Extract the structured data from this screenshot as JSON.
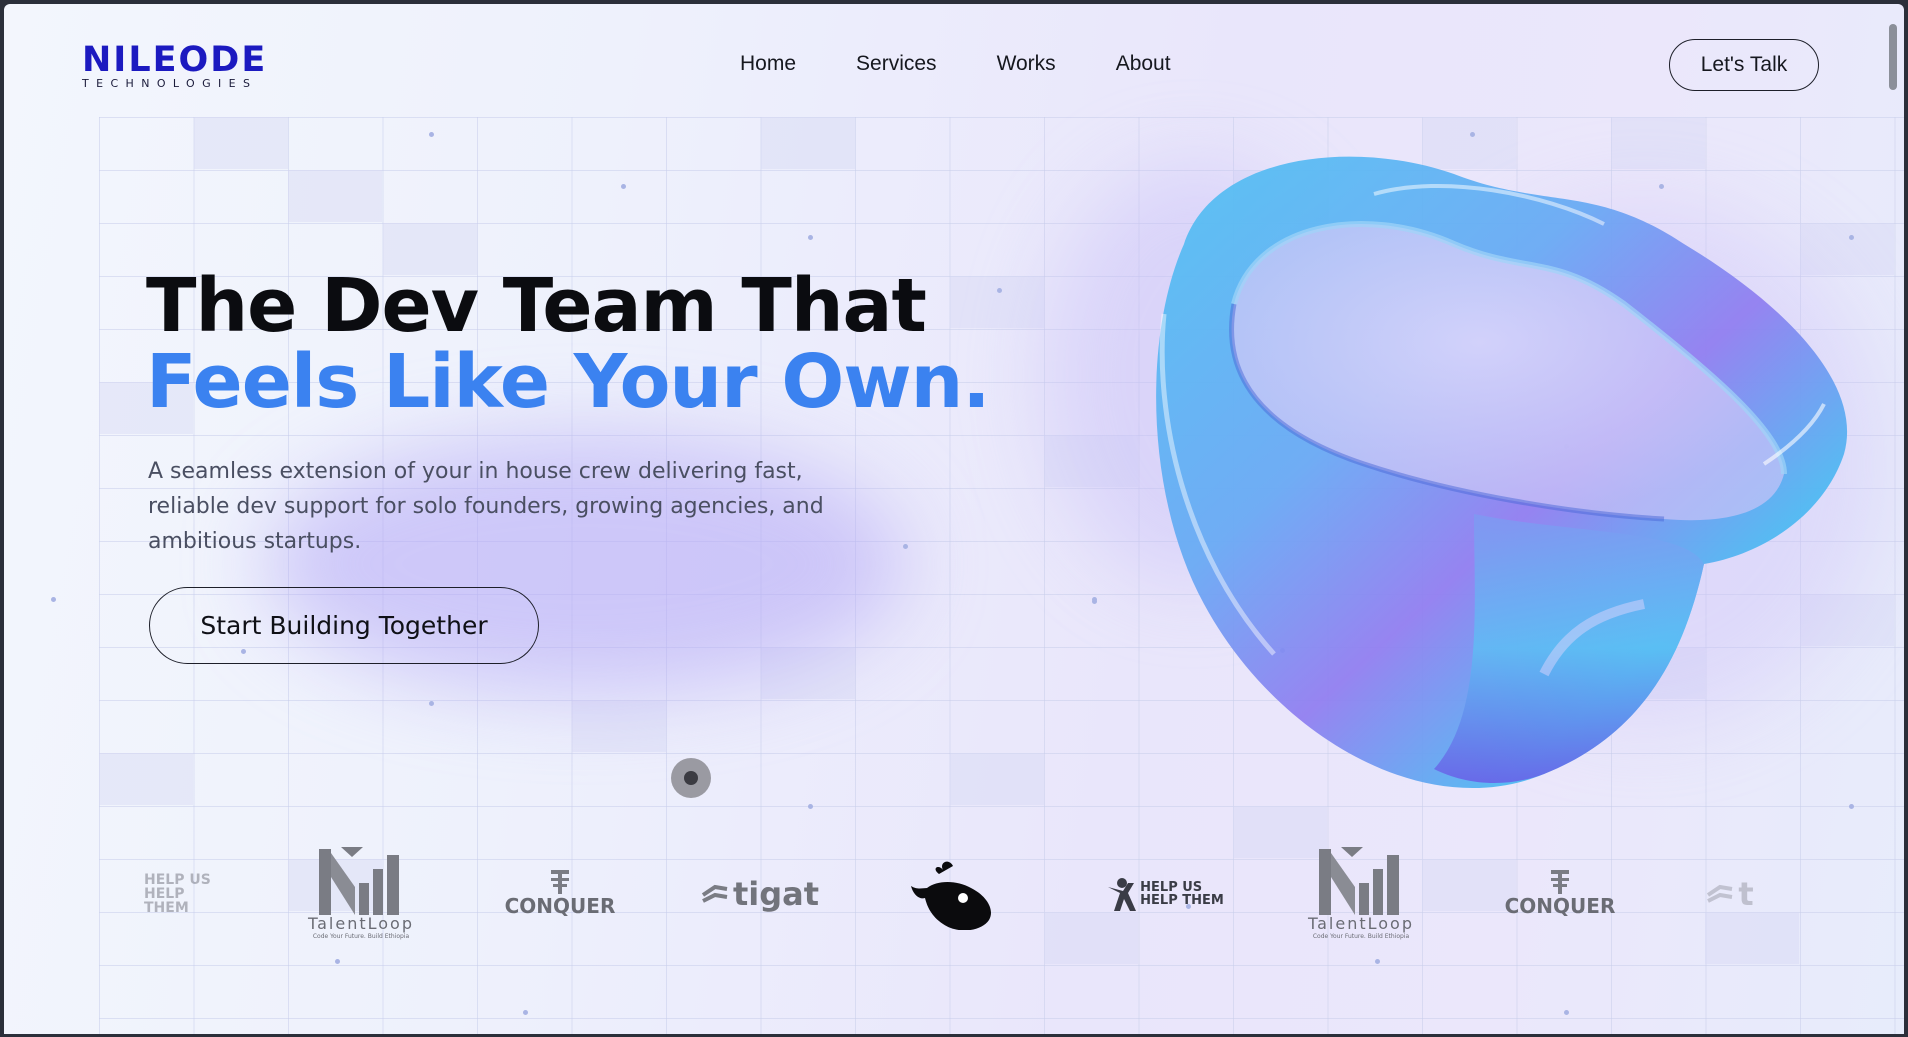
{
  "brand": {
    "name": "NILEODE",
    "tagline": "TECHNOLOGIES",
    "color": "#1c1ac0"
  },
  "nav": {
    "items": [
      {
        "label": "Home"
      },
      {
        "label": "Services"
      },
      {
        "label": "Works"
      },
      {
        "label": "About"
      }
    ],
    "cta_label": "Let's Talk"
  },
  "hero": {
    "title_line1": "The Dev Team That",
    "title_line2": "Feels Like Your Own.",
    "accent_color": "#3b82f0",
    "description_line1": "A seamless extension of your in house crew delivering fast,",
    "description_line2": "reliable dev support for solo founders, growing agencies, and",
    "description_line3": "ambitious startups.",
    "cta_label": "Start Building Together"
  },
  "clients": {
    "logos": [
      {
        "name": "help-us-help-them-logo",
        "line1": "HELP US",
        "line2": "HELP THEM"
      },
      {
        "name": "talentloop-logo",
        "text": "TalentLoop",
        "sub": "Code Your Future. Build Ethiopia"
      },
      {
        "name": "conquer-logo",
        "text": "CONQUER"
      },
      {
        "name": "tigat-logo",
        "text": "tigat"
      },
      {
        "name": "whale-logo"
      },
      {
        "name": "help-us-help-them-logo",
        "line1": "HELP US",
        "line2": "HELP THEM"
      },
      {
        "name": "talentloop-logo",
        "text": "TalentLoop",
        "sub": "Code Your Future. Build Ethiopia"
      },
      {
        "name": "conquer-logo",
        "text": "CONQUER"
      },
      {
        "name": "tigat-logo",
        "text": "t"
      }
    ]
  }
}
